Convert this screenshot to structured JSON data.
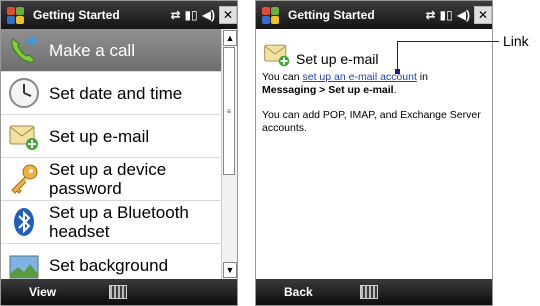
{
  "left": {
    "title": "Getting Started",
    "items": [
      {
        "label": "Make a call",
        "icon": "phone-arrow-icon",
        "selected": true
      },
      {
        "label": "Set date and time",
        "icon": "clock-icon"
      },
      {
        "label": "Set up e-mail",
        "icon": "email-envelope-icon"
      },
      {
        "label": "Set up a device password",
        "line1": "Set up a device",
        "line2": "password",
        "icon": "key-icon"
      },
      {
        "label": "Set up a Bluetooth headset",
        "line1": "Set up a Bluetooth",
        "line2": "headset",
        "icon": "bluetooth-icon"
      },
      {
        "label": "Set background",
        "icon": "picture-icon"
      }
    ],
    "softkey": "View"
  },
  "right": {
    "title": "Getting Started",
    "heading": "Set up e-mail",
    "para1_pre": "You can ",
    "para1_link": "set up an e-mail account",
    "para1_mid": " in",
    "para1_bold": "Messaging > Set up e-mail",
    "para1_end": ".",
    "para2": "You can add POP, IMAP, and Exchange Server accounts.",
    "softkey": "Back"
  },
  "callout": {
    "label": "Link"
  },
  "colors": {
    "titlebar": "#141414",
    "link": "#1a3fcf",
    "selection": "#7a7a7a"
  }
}
